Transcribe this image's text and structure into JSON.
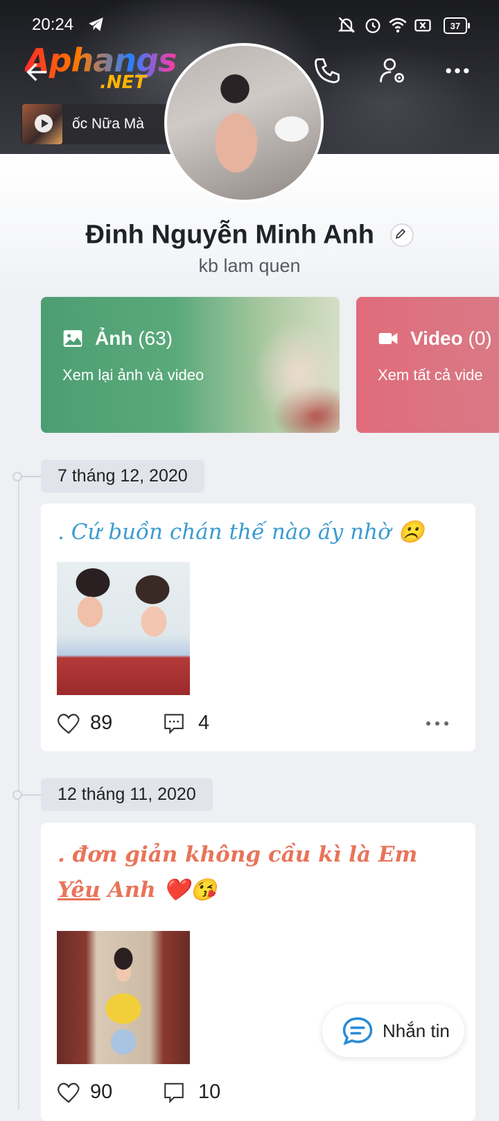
{
  "status_bar": {
    "time": "20:24",
    "battery": "37"
  },
  "header": {
    "watermark_top": "Aphangs",
    "watermark_bottom": ".NET",
    "now_playing": "ốc Nữa Mà"
  },
  "profile": {
    "name": "Đinh Nguyễn Minh Anh",
    "bio": "kb lam quen"
  },
  "media_cards": [
    {
      "title": "Ảnh",
      "count": "(63)",
      "subtitle": "Xem lại ảnh và video",
      "color": "#4c9e72"
    },
    {
      "title": "Video",
      "count": "(0)",
      "subtitle": "Xem tất cả vide",
      "color": "#e06c7b"
    }
  ],
  "posts": [
    {
      "date": "7 tháng 12, 2020",
      "text": ". Cứ buồn chán thế nào ấy nhờ ☹️",
      "text_color": "#3b9bd0",
      "likes": "89",
      "comments": "4"
    },
    {
      "date": "12 tháng 11, 2020",
      "text_line1": ". đơn giản không cầu kì là Em",
      "text_line2_underlined": "Yêu",
      "text_line2_rest": " Anh ❤️😘",
      "text_color": "#e8745a",
      "likes": "90",
      "comments": "10"
    }
  ],
  "fab": {
    "label": "Nhắn tin"
  }
}
